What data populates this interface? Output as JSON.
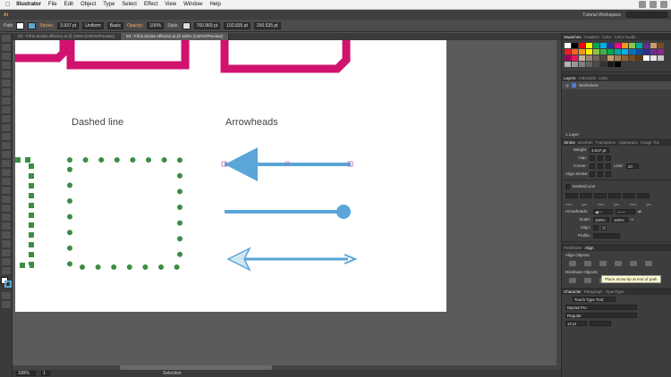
{
  "menubar": {
    "apple": "",
    "app_name": "Illustrator",
    "items": [
      "File",
      "Edit",
      "Object",
      "Type",
      "Select",
      "Effect",
      "View",
      "Window",
      "Help"
    ]
  },
  "appbar": {
    "workspace": "Tutorial Workspace",
    "logo": "Ai"
  },
  "control_bar": {
    "selection": "Path",
    "stroke_label": "Stroke:",
    "stroke_weight": "3.937 pt",
    "uniform_label": "Uniform",
    "basic_label": "Basic",
    "opacity_label": "Opacity:",
    "opacity_value": "100%",
    "style_label": "Style:",
    "x_value": "760.869 pt",
    "y_value": "192.835 pt",
    "w_value": "200.535 pt"
  },
  "doc_tabs": [
    {
      "label": "03 - Fill & Stroke effects1.ai @ 100% (CMYK/Preview)",
      "active": false
    },
    {
      "label": "03 - Fill & Stroke effects2.ai @ 100% (CMYK/Preview)",
      "active": true
    }
  ],
  "artboard": {
    "dashed_heading": "Dashed line",
    "arrow_heading": "Arrowheads",
    "colors": {
      "magenta": "#d1136f",
      "green": "#3c8d43",
      "blue": "#5aa6d8"
    }
  },
  "panels": {
    "swatches_tabs": [
      "Swatches",
      "Gradient",
      "Color",
      "Color Guide"
    ],
    "layers_tabs": [
      "Layers",
      "Artboards",
      "Links"
    ],
    "layer_name": "Worksheet",
    "layer_count": "1 Layer",
    "stroke_tabs": [
      "Stroke",
      "Brushes",
      "Transparen",
      "Appearanc",
      "Image Tra"
    ],
    "weight_label": "Weight:",
    "weight_value": "3.937 pt",
    "cap_label": "Cap:",
    "corner_label": "Corner:",
    "limit_label": "Limit:",
    "limit_value": "10",
    "align_stroke_label": "Align Stroke:",
    "dashed_line_label": "Dashed Line",
    "dash_fields": [
      "dash",
      "gap",
      "dash",
      "gap",
      "dash",
      "gap"
    ],
    "arrowheads_label": "Arrowheads:",
    "scale_label": "Scale:",
    "scale_start": "100%",
    "scale_end": "100%",
    "align_label": "Align:",
    "profile_label": "Profile:",
    "tooltip": "Place arrow tip at end of path",
    "pathfinder_tabs": [
      "Pathfinder",
      "Align"
    ],
    "align_objects_label": "Align Objects:",
    "distribute_objects_label": "Distribute Objects:",
    "char_tabs": [
      "Character",
      "Paragraph",
      "OpenType"
    ],
    "touch_type": "Touch Type Tool",
    "font_name": "Myriad Pro",
    "font_style": "Regular",
    "font_size": "12 pt"
  },
  "status": {
    "zoom": "100%",
    "page": "1",
    "tool": "Selection"
  },
  "swatch_colors": [
    "#ffffff",
    "#000000",
    "#ff0000",
    "#ffff00",
    "#00a650",
    "#00adef",
    "#2e3192",
    "#ec008c",
    "#f7941d",
    "#8dc63f",
    "#00a99d",
    "#662d91",
    "#c69c6d",
    "#754c24",
    "#ed1c24",
    "#f26522",
    "#f7941d",
    "#fff200",
    "#8dc63f",
    "#39b54a",
    "#00a651",
    "#00a99d",
    "#00aeef",
    "#0072bc",
    "#0054a6",
    "#2e3192",
    "#662d91",
    "#92278f",
    "#9e005d",
    "#ed145b",
    "#c2b59b",
    "#998675",
    "#736357",
    "#534741",
    "#c69c6d",
    "#a67c52",
    "#8c6239",
    "#754c24",
    "#603913",
    "#ffffff",
    "#e6e6e6",
    "#cccccc",
    "#b3b3b3",
    "#999999",
    "#808080",
    "#666666",
    "#4d4d4d",
    "#333333",
    "#1a1a1a",
    "#000000"
  ]
}
